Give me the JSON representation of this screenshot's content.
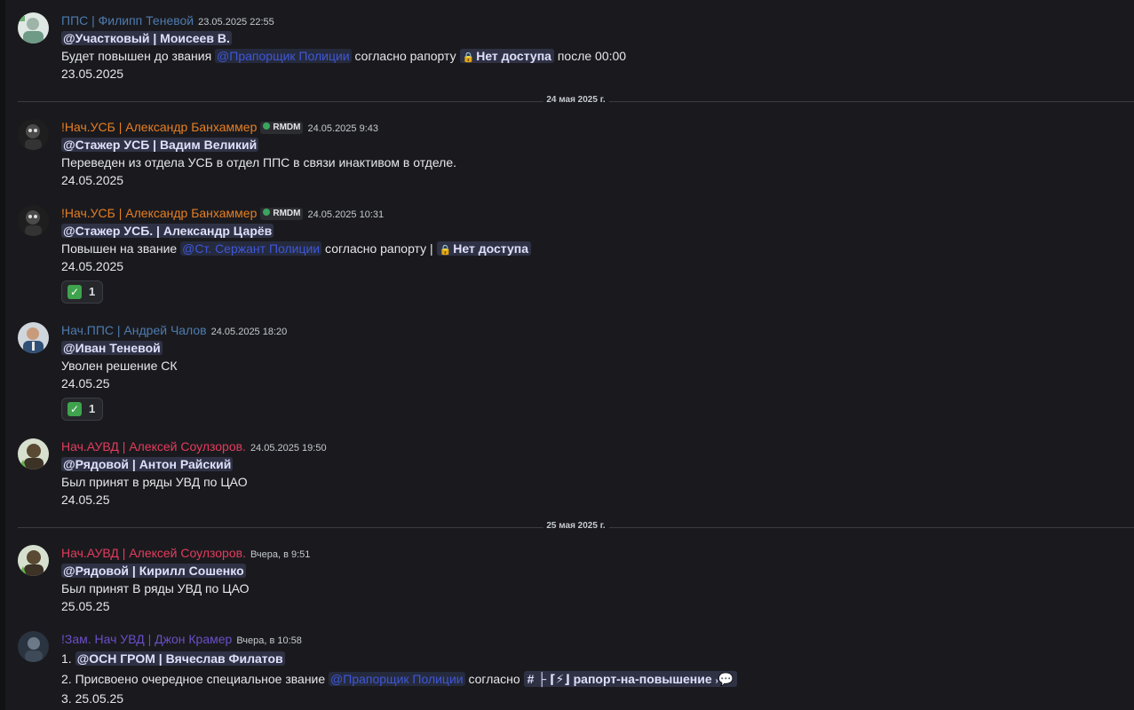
{
  "messages": [
    {
      "author": "ППС | Филипп Теневой",
      "author_color": "#4d7bb0",
      "timestamp": "23.05.2025 22:55",
      "lines": {
        "l1_mention": "@Участковый | Моисеев В.",
        "l2_pre": "Будет повышен до звания",
        "l2_role": "@Прапорщик Полиции",
        "l2_mid": "согласно рапорту",
        "l2_locked": "Нет доступа",
        "l2_post": "после 00:00",
        "l3": "23.05.2025"
      }
    },
    {
      "author": "!Нач.УСБ | Александр Банхаммер",
      "author_color": "#e67e22",
      "badge": "RMDM",
      "timestamp": "24.05.2025 9:43",
      "lines": {
        "l1_mention": "@Стажер УСБ | Вадим Великий",
        "l2": "Переведен из отдела УСБ в отдел ППС в связи инактивом в отделе.",
        "l3": "24.05.2025"
      }
    },
    {
      "author": "!Нач.УСБ | Александр Банхаммер",
      "author_color": "#e67e22",
      "badge": "RMDM",
      "timestamp": "24.05.2025 10:31",
      "lines": {
        "l1_mention": "@Стажер УСБ. | Александр Царёв",
        "l2_pre": "Повышен на звание",
        "l2_role": "@Ст. Сержант Полиции",
        "l2_mid": "согласно рапорту |",
        "l2_locked": "Нет доступа",
        "l3": "24.05.2025"
      },
      "reaction": {
        "emoji": "white-check-mark",
        "count": "1"
      }
    },
    {
      "author": "Нач.ППС | Андрей Чалов",
      "author_color": "#4d7bb0",
      "timestamp": "24.05.2025 18:20",
      "lines": {
        "l1_mention": "@Иван Теневой",
        "l2": "Уволен решение СК",
        "l3": "24.05.25"
      },
      "reaction": {
        "emoji": "white-check-mark",
        "count": "1"
      }
    },
    {
      "author": "Нач.АУВД | Алексей Соулзоров.",
      "author_color": "#e23c5d",
      "timestamp": "24.05.2025 19:50",
      "lines": {
        "l1_mention": "@Рядовой | Антон Райский",
        "l2": "Был принят в ряды УВД по ЦАО",
        "l3": "24.05.25"
      }
    },
    {
      "author": "Нач.АУВД | Алексей Соулзоров.",
      "author_color": "#e23c5d",
      "timestamp": "Вчера, в 9:51",
      "lines": {
        "l1_mention": "@Рядовой | Кирилл Сошенко",
        "l2": "Был принят В ряды УВД по ЦАО",
        "l3": "25.05.25"
      }
    },
    {
      "author": "!Зам. Нач УВД | Джон Крамер",
      "author_color": "#6a4fc8",
      "timestamp": "Вчера, в 10:58",
      "lines": {
        "l1_pre": "1.",
        "l1_mention": "@ОСН ГРОМ | Вячеслав Филатов",
        "l2_pre": "2. Присвоено очередное специальное звание",
        "l2_role": "@Прапорщик Полиции",
        "l2_mid": "согласно",
        "l2_channel": "├ ⌈⚡⌋ рапорт-на-повышение",
        "l3": "3. 25.05.25"
      }
    }
  ],
  "dividers": {
    "d1": "24 мая 2025 г.",
    "d2": "25 мая 2025 г."
  }
}
